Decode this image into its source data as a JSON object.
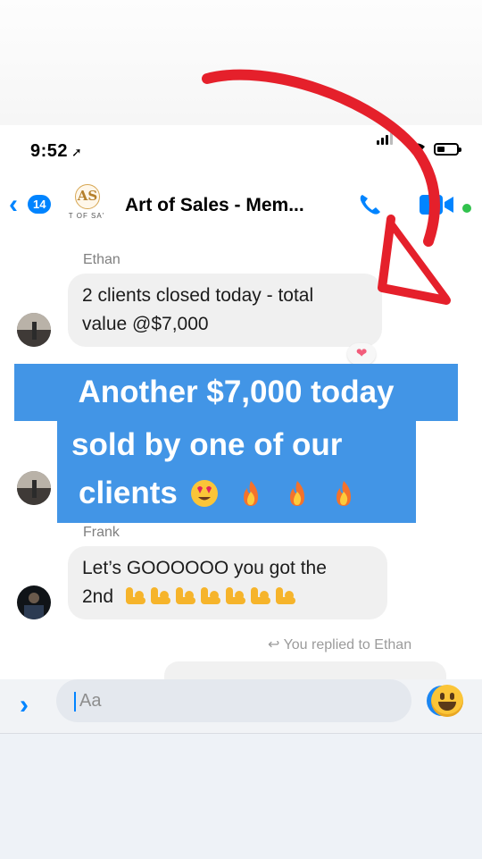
{
  "status": {
    "time": "9:52",
    "arrow": "➚"
  },
  "header": {
    "back_count": "14",
    "back_icon": "‹",
    "title": "Art of Sales - Mem...",
    "logo_initials": "AS",
    "logo_subtext": "T OF SA'"
  },
  "messages": [
    {
      "sender": "Ethan",
      "lines": [
        "2 clients closed today - total",
        "value @$7,000"
      ],
      "reaction": "❤"
    },
    {
      "sender": "Frank",
      "lines": [
        "Let’s GOOOOOO you got the",
        "2nd"
      ]
    }
  ],
  "overlay": {
    "line1": "Another $7,000 today",
    "line2": "sold by one of our",
    "line3": "clients"
  },
  "replied": {
    "icon": "↩",
    "text": "You replied to Ethan"
  },
  "composer": {
    "expand_icon": "›",
    "placeholder": "Aa"
  },
  "colors": {
    "accent": "#0084ff",
    "overlay": "#4295e6",
    "annotation": "#e5202b",
    "online": "#31c24d"
  }
}
